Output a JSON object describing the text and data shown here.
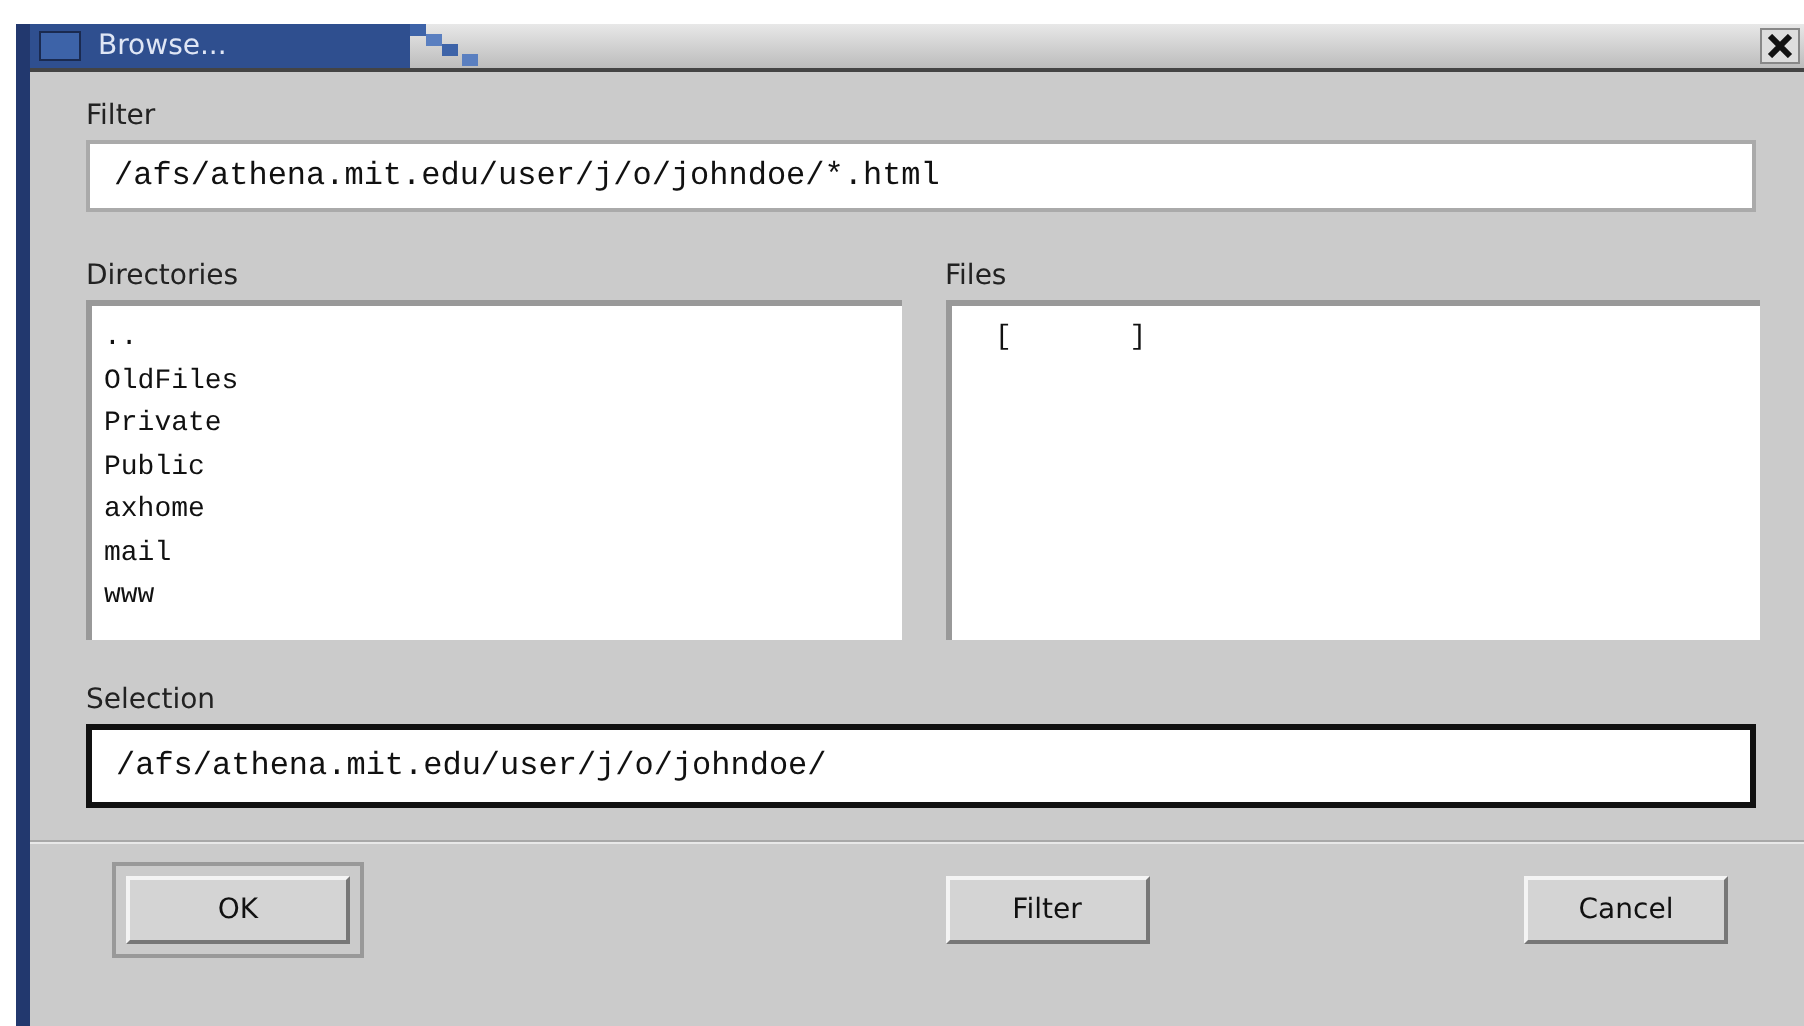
{
  "window": {
    "title": "Browse..."
  },
  "filter": {
    "label": "Filter",
    "value": "/afs/athena.mit.edu/user/j/o/johndoe/*.html",
    "focused": false
  },
  "directories": {
    "label": "Directories",
    "items": [
      {
        "name": ".."
      },
      {
        "name": "OldFiles"
      },
      {
        "name": "Private"
      },
      {
        "name": "Public"
      },
      {
        "name": "axhome"
      },
      {
        "name": "mail"
      },
      {
        "name": "www"
      }
    ]
  },
  "files": {
    "label": "Files",
    "items": [
      {
        "name": "[       ]"
      }
    ]
  },
  "selection": {
    "label": "Selection",
    "value": "/afs/athena.mit.edu/user/j/o/johndoe/",
    "focused": true
  },
  "buttons": [
    {
      "label": "OK",
      "default": true
    },
    {
      "label": "Filter",
      "default": false
    },
    {
      "label": "Cancel",
      "default": false
    }
  ]
}
